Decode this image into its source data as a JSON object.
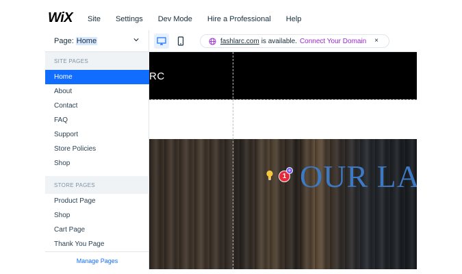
{
  "app": {
    "logo": "WiX"
  },
  "menu": [
    "Site",
    "Settings",
    "Dev Mode",
    "Hire a Professional",
    "Help"
  ],
  "page_selector": {
    "label": "Page:",
    "value": "Home"
  },
  "domain_bar": {
    "domain": "fashlarc.com",
    "text": "is available.",
    "connect": "Connect Your Domain",
    "close": "×"
  },
  "sidebar": {
    "site_pages_header": "SITE PAGES",
    "site_pages": [
      "Home",
      "About",
      "Contact",
      "FAQ",
      "Support",
      "Store Policies",
      "Shop"
    ],
    "store_pages_header": "STORE PAGES",
    "store_pages": [
      "Product Page",
      "Shop",
      "Cart Page",
      "Thank You Page"
    ],
    "manage_label": "Manage Pages",
    "active": "Home"
  },
  "canvas": {
    "site_name_fragment": "RC",
    "hero_title": "OUR LA",
    "notification_count": "1",
    "add_symbol": "+"
  },
  "colors": {
    "accent": "#116dff",
    "connect": "#9a27d5",
    "badge": "#e62a3a",
    "hero_title": "#3e7ac4"
  }
}
